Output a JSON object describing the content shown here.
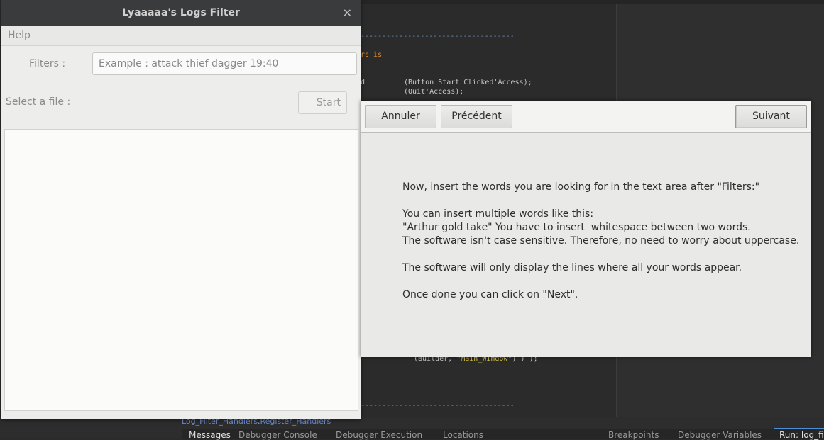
{
  "log_window": {
    "title": "Lyaaaaa's Logs Filter",
    "close_symbol": "×",
    "menu": {
      "help": "Help"
    },
    "filters_label": "Filters :",
    "filters_placeholder": "Example : attack thief dagger 19:40",
    "filters_value": "",
    "select_file_label": "Select a file :",
    "start_button": "Start"
  },
  "assistant": {
    "buttons": {
      "cancel": "Annuler",
      "previous": "Précédent",
      "next": "Suivant"
    },
    "instructions": [
      "Now, insert the words you are looking for in the text area after \"Filters:\"",
      "You can insert multiple words like this:",
      "\"Arthur gold take\" You have to insert  whitespace between two words.",
      "The software isn't case sensitive. Therefore, no need to worry about uppercase.",
      "The software will only display the lines where all your words appear.",
      "Once done you can click on \"Next\"."
    ]
  },
  "ide": {
    "code_lines": {
      "dash_top": "------------------------------------",
      "rs_is": "rs is",
      "paren_d": "d",
      "button_start": "(Button_Start_Clicked'Access);",
      "quit": "(Quit'Access);",
      "builder_prefix": "(Builder, ",
      "builder_str": "\"Main_Window\"",
      "builder_suffix": ") ) );",
      "dash_bottom": "------------------------------------"
    },
    "breadcrumb": {
      "part1": "Log_Filter_Handlers",
      "separator": ".",
      "part2": "Register_Handlers"
    },
    "bottom_tabs": [
      "Messages",
      "Debugger Console",
      "Debugger Execution",
      "Locations",
      "Breakpoints",
      "Debugger Variables",
      "Run: log_fi"
    ],
    "accent_color": "#4a8fd8"
  }
}
